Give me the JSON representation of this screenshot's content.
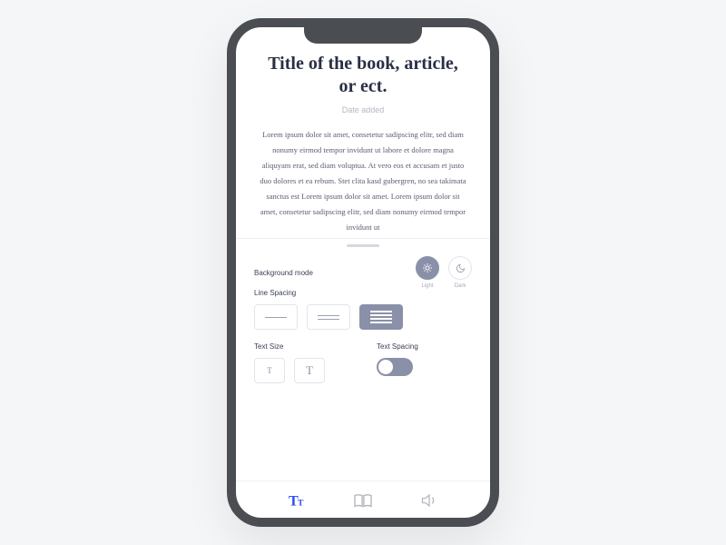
{
  "title": "Title of the book, article, or ect.",
  "date_added": "Date added",
  "body": "Lorem ipsum dolor sit amet, consetetur sadipscing elitr, sed diam nonumy eirmod tempor invidunt ut labore et dolore magna aliquyam erat, sed diam voluptua. At vero eos et accusam et justo duo dolores et ea rebum. Stet clita kasd gubergren, no sea takimata sanctus est Lorem ipsum dolor sit amet. Lorem ipsum dolor sit amet, consetetur sadipscing elitr, sed diam nonumy eirmod tempor invidunt ut",
  "settings": {
    "background_mode": {
      "label": "Background mode",
      "options": {
        "light": "Light",
        "dark": "Dark"
      },
      "selected": "light"
    },
    "line_spacing": {
      "label": "Line Spacing",
      "selected": "dense"
    },
    "text_size": {
      "label": "Text Size",
      "glyph": "T"
    },
    "text_spacing": {
      "label": "Text Spacing",
      "enabled": false
    }
  },
  "colors": {
    "accent": "#2d4ef5",
    "muted": "#8a90a8"
  }
}
